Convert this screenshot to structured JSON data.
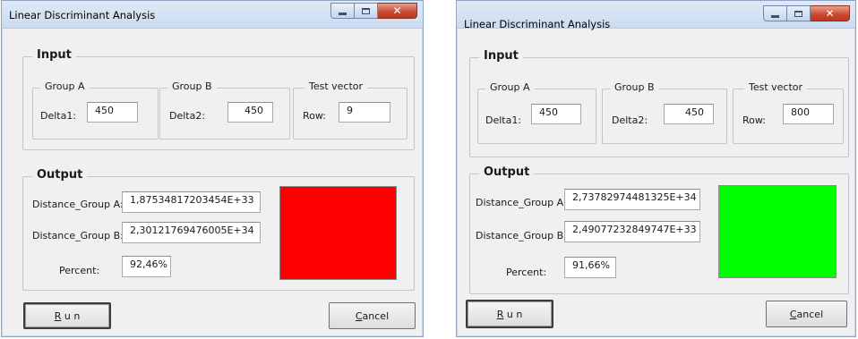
{
  "windows": [
    {
      "title": "Linear Discriminant Analysis",
      "input": {
        "legend": "Input",
        "group_a": {
          "legend": "Group A",
          "label": "Delta1:",
          "value": "450"
        },
        "group_b": {
          "legend": "Group B",
          "label": "Delta2:",
          "value": "450"
        },
        "test_vector": {
          "legend": "Test vector",
          "label": "Row:",
          "value": "9"
        }
      },
      "output": {
        "legend": "Output",
        "dist_a_label": "Distance_Group A:",
        "dist_a_value": "1,87534817203454E+33",
        "dist_b_label": "Distance_Group B:",
        "dist_b_value": "2,30121769476005E+34",
        "percent_label": "Percent:",
        "percent_value": "92,46%",
        "swatch_color": "#ff0000"
      },
      "buttons": {
        "run_key": "R",
        "run_rest": " u n",
        "cancel_key": "C",
        "cancel_rest": "ancel"
      }
    },
    {
      "title": "Linear Discriminant Analysis",
      "input": {
        "legend": "Input",
        "group_a": {
          "legend": "Group A",
          "label": "Delta1:",
          "value": "450"
        },
        "group_b": {
          "legend": "Group B",
          "label": "Delta2:",
          "value": "450"
        },
        "test_vector": {
          "legend": "Test vector",
          "label": "Row:",
          "value": "800"
        }
      },
      "output": {
        "legend": "Output",
        "dist_a_label": "Distance_Group A:",
        "dist_a_value": "2,73782974481325E+34",
        "dist_b_label": "Distance_Group B:",
        "dist_b_value": "2,49077232849747E+33",
        "percent_label": "Percent:",
        "percent_value": "91,66%",
        "swatch_color": "#00ff00"
      },
      "buttons": {
        "run_key": "R",
        "run_rest": " u n",
        "cancel_key": "C",
        "cancel_rest": "ancel"
      }
    }
  ]
}
